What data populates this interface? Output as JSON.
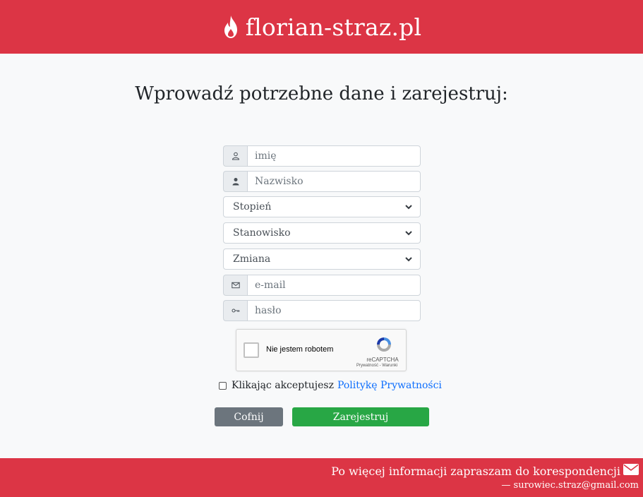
{
  "header": {
    "brand": "florian-straz.pl",
    "icon": "fire-icon"
  },
  "page": {
    "heading": "Wprowadź potrzebne dane i zarejestruj:"
  },
  "form": {
    "first_name_placeholder": "imię",
    "last_name_placeholder": "Nazwisko",
    "rank_select": "Stopień",
    "position_select": "Stanowisko",
    "shift_select": "Zmiana",
    "email_placeholder": "e-mail",
    "password_placeholder": "hasło"
  },
  "recaptcha": {
    "label": "Nie jestem robotem",
    "brand": "reCAPTCHA",
    "links": "Prywatność - Warunki"
  },
  "consent": {
    "text": "Klikając akceptujesz",
    "link": "Politykę Prywatności"
  },
  "buttons": {
    "back": "Cofnij",
    "register": "Zarejestruj"
  },
  "footer": {
    "info": "Po więcej informacji zapraszam do korespondencji",
    "email": "— surowiec.straz@gmail.com"
  },
  "colors": {
    "brand": "#dc3545",
    "back_button": "#6c757d",
    "register_button": "#28a745",
    "link": "#0d6efd"
  }
}
